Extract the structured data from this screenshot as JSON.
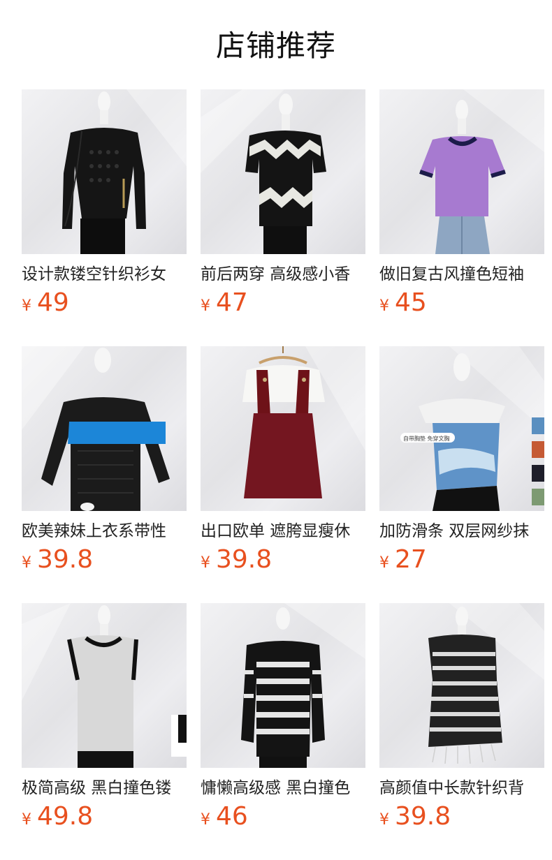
{
  "section": {
    "title": "店铺推荐"
  },
  "currency_symbol": "¥",
  "products": [
    {
      "name": "设计款镂空针织衫女",
      "price": "49",
      "image": "black-openknit-sweater"
    },
    {
      "name": "前后两穿 高级感小香",
      "price": "47",
      "image": "black-white-chevron-knit-top"
    },
    {
      "name": "做旧复古风撞色短袖",
      "price": "45",
      "image": "purple-short-sleeve-knit"
    },
    {
      "name": "欧美辣妹上衣系带性",
      "price": "39.8",
      "image": "black-blue-stripe-knit"
    },
    {
      "name": "出口欧单 遮胯显瘦休",
      "price": "39.8",
      "image": "burgundy-overall-dress"
    },
    {
      "name": "加防滑条 双层网纱抹",
      "price": "27",
      "image": "blue-mesh-tube-top",
      "image_tag": "自带胸垫 免穿文胸"
    },
    {
      "name": "极简高级 黑白撞色镂",
      "price": "49.8",
      "image": "white-mesh-vest"
    },
    {
      "name": "慵懒高级感 黑白撞色",
      "price": "46",
      "image": "black-white-stripe-cardigan"
    },
    {
      "name": "高颜值中长款针织背",
      "price": "39.8",
      "image": "striped-long-knit-vest"
    }
  ]
}
